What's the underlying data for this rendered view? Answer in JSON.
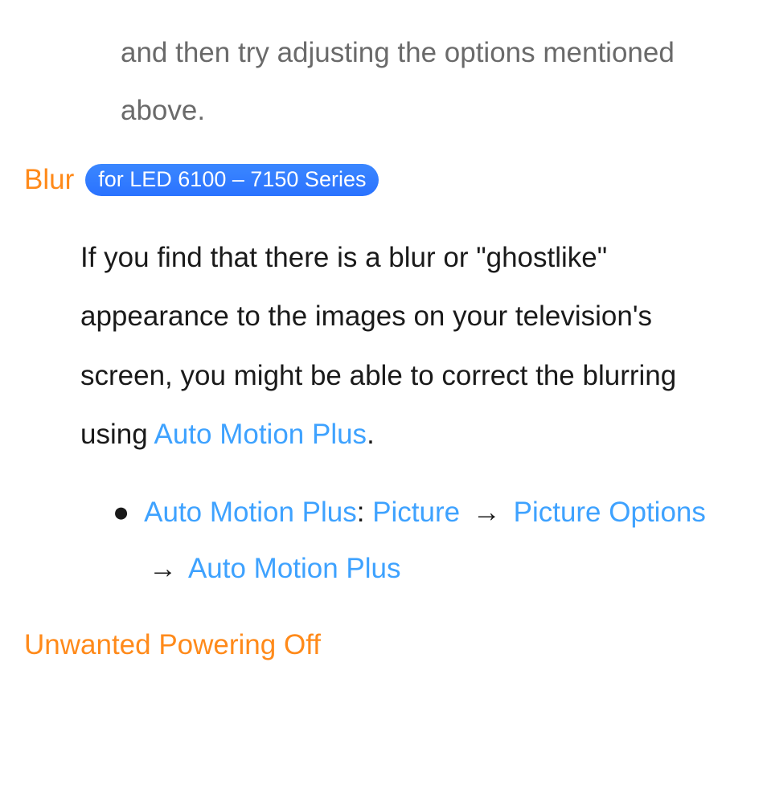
{
  "continuation": "and then try adjusting the options mentioned above.",
  "blur": {
    "title": "Blur",
    "badge": "for LED 6100 – 7150 Series",
    "body_pre": "If you find that there is a blur or \"ghostlike\" appearance to the images on your television's screen, you might be able to correct the blurring using ",
    "body_link": "Auto Motion Plus",
    "body_period": ".",
    "path": {
      "label": "Auto Motion Plus",
      "colon": ": ",
      "step1": "Picture",
      "arrow": "→",
      "step2": "Picture Options",
      "step3": "Auto Motion Plus"
    }
  },
  "next_section": {
    "title": "Unwanted Powering Off"
  }
}
